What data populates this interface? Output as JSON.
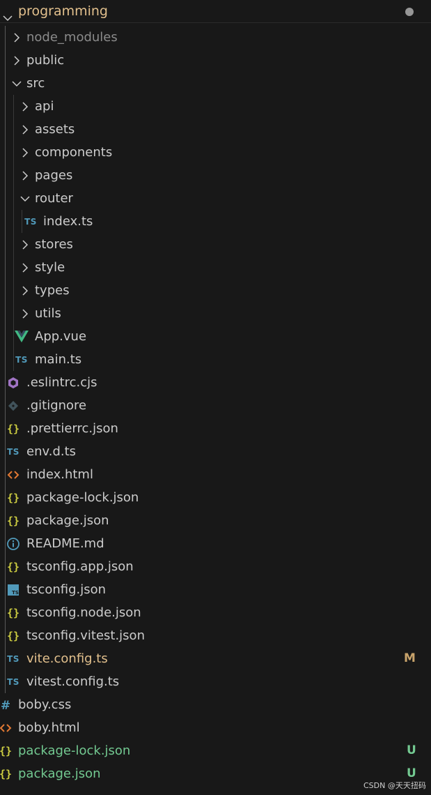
{
  "explorer": {
    "title": "programming",
    "status_dot_color": "#c0c0c0"
  },
  "colors": {
    "default_text": "#cccccc",
    "dim_text": "#8b8b8b",
    "modified_text": "#e2c08d",
    "untracked_text": "#73c991",
    "ts_icon": "#519aba",
    "vue_icon": "#41b883",
    "json_icon": "#cbcb41",
    "html_icon": "#e37933",
    "eslint_icon": "#a074c4",
    "css_icon": "#519aba"
  },
  "tree": [
    {
      "label": "node_modules",
      "type": "folder",
      "expanded": false,
      "depth": 1,
      "dim": true
    },
    {
      "label": "public",
      "type": "folder",
      "expanded": false,
      "depth": 1
    },
    {
      "label": "src",
      "type": "folder",
      "expanded": true,
      "depth": 1
    },
    {
      "label": "api",
      "type": "folder",
      "expanded": false,
      "depth": 2
    },
    {
      "label": "assets",
      "type": "folder",
      "expanded": false,
      "depth": 2
    },
    {
      "label": "components",
      "type": "folder",
      "expanded": false,
      "depth": 2
    },
    {
      "label": "pages",
      "type": "folder",
      "expanded": false,
      "depth": 2
    },
    {
      "label": "router",
      "type": "folder",
      "expanded": true,
      "depth": 2
    },
    {
      "label": "index.ts",
      "type": "file",
      "icon": "ts-icon",
      "depth": 3
    },
    {
      "label": "stores",
      "type": "folder",
      "expanded": false,
      "depth": 2
    },
    {
      "label": "style",
      "type": "folder",
      "expanded": false,
      "depth": 2
    },
    {
      "label": "types",
      "type": "folder",
      "expanded": false,
      "depth": 2
    },
    {
      "label": "utils",
      "type": "folder",
      "expanded": false,
      "depth": 2
    },
    {
      "label": "App.vue",
      "type": "file",
      "icon": "vue-icon",
      "depth": 2
    },
    {
      "label": "main.ts",
      "type": "file",
      "icon": "ts-icon",
      "depth": 2
    },
    {
      "label": ".eslintrc.cjs",
      "type": "file",
      "icon": "eslint-icon",
      "depth": 1
    },
    {
      "label": ".gitignore",
      "type": "file",
      "icon": "git-icon",
      "depth": 1
    },
    {
      "label": ".prettierrc.json",
      "type": "file",
      "icon": "json-icon",
      "depth": 1
    },
    {
      "label": "env.d.ts",
      "type": "file",
      "icon": "ts-icon",
      "depth": 1
    },
    {
      "label": "index.html",
      "type": "file",
      "icon": "html-icon",
      "depth": 1
    },
    {
      "label": "package-lock.json",
      "type": "file",
      "icon": "json-icon",
      "depth": 1
    },
    {
      "label": "package.json",
      "type": "file",
      "icon": "json-icon",
      "depth": 1
    },
    {
      "label": "README.md",
      "type": "file",
      "icon": "info-icon",
      "depth": 1
    },
    {
      "label": "tsconfig.app.json",
      "type": "file",
      "icon": "json-icon",
      "depth": 1
    },
    {
      "label": "tsconfig.json",
      "type": "file",
      "icon": "tsconfig-icon",
      "depth": 1
    },
    {
      "label": "tsconfig.node.json",
      "type": "file",
      "icon": "json-icon",
      "depth": 1
    },
    {
      "label": "tsconfig.vitest.json",
      "type": "file",
      "icon": "json-icon",
      "depth": 1
    },
    {
      "label": "vite.config.ts",
      "type": "file",
      "icon": "ts-icon",
      "depth": 1,
      "status": "M"
    },
    {
      "label": "vitest.config.ts",
      "type": "file",
      "icon": "ts-icon",
      "depth": 1
    },
    {
      "label": "boby.css",
      "type": "file",
      "icon": "css-icon",
      "depth": 0
    },
    {
      "label": "boby.html",
      "type": "file",
      "icon": "html-icon",
      "depth": 0
    },
    {
      "label": "package-lock.json",
      "type": "file",
      "icon": "json-icon",
      "depth": 0,
      "status": "U"
    },
    {
      "label": "package.json",
      "type": "file",
      "icon": "json-icon",
      "depth": 0,
      "status": "U"
    }
  ],
  "watermark": "CSDN @天天扭码"
}
